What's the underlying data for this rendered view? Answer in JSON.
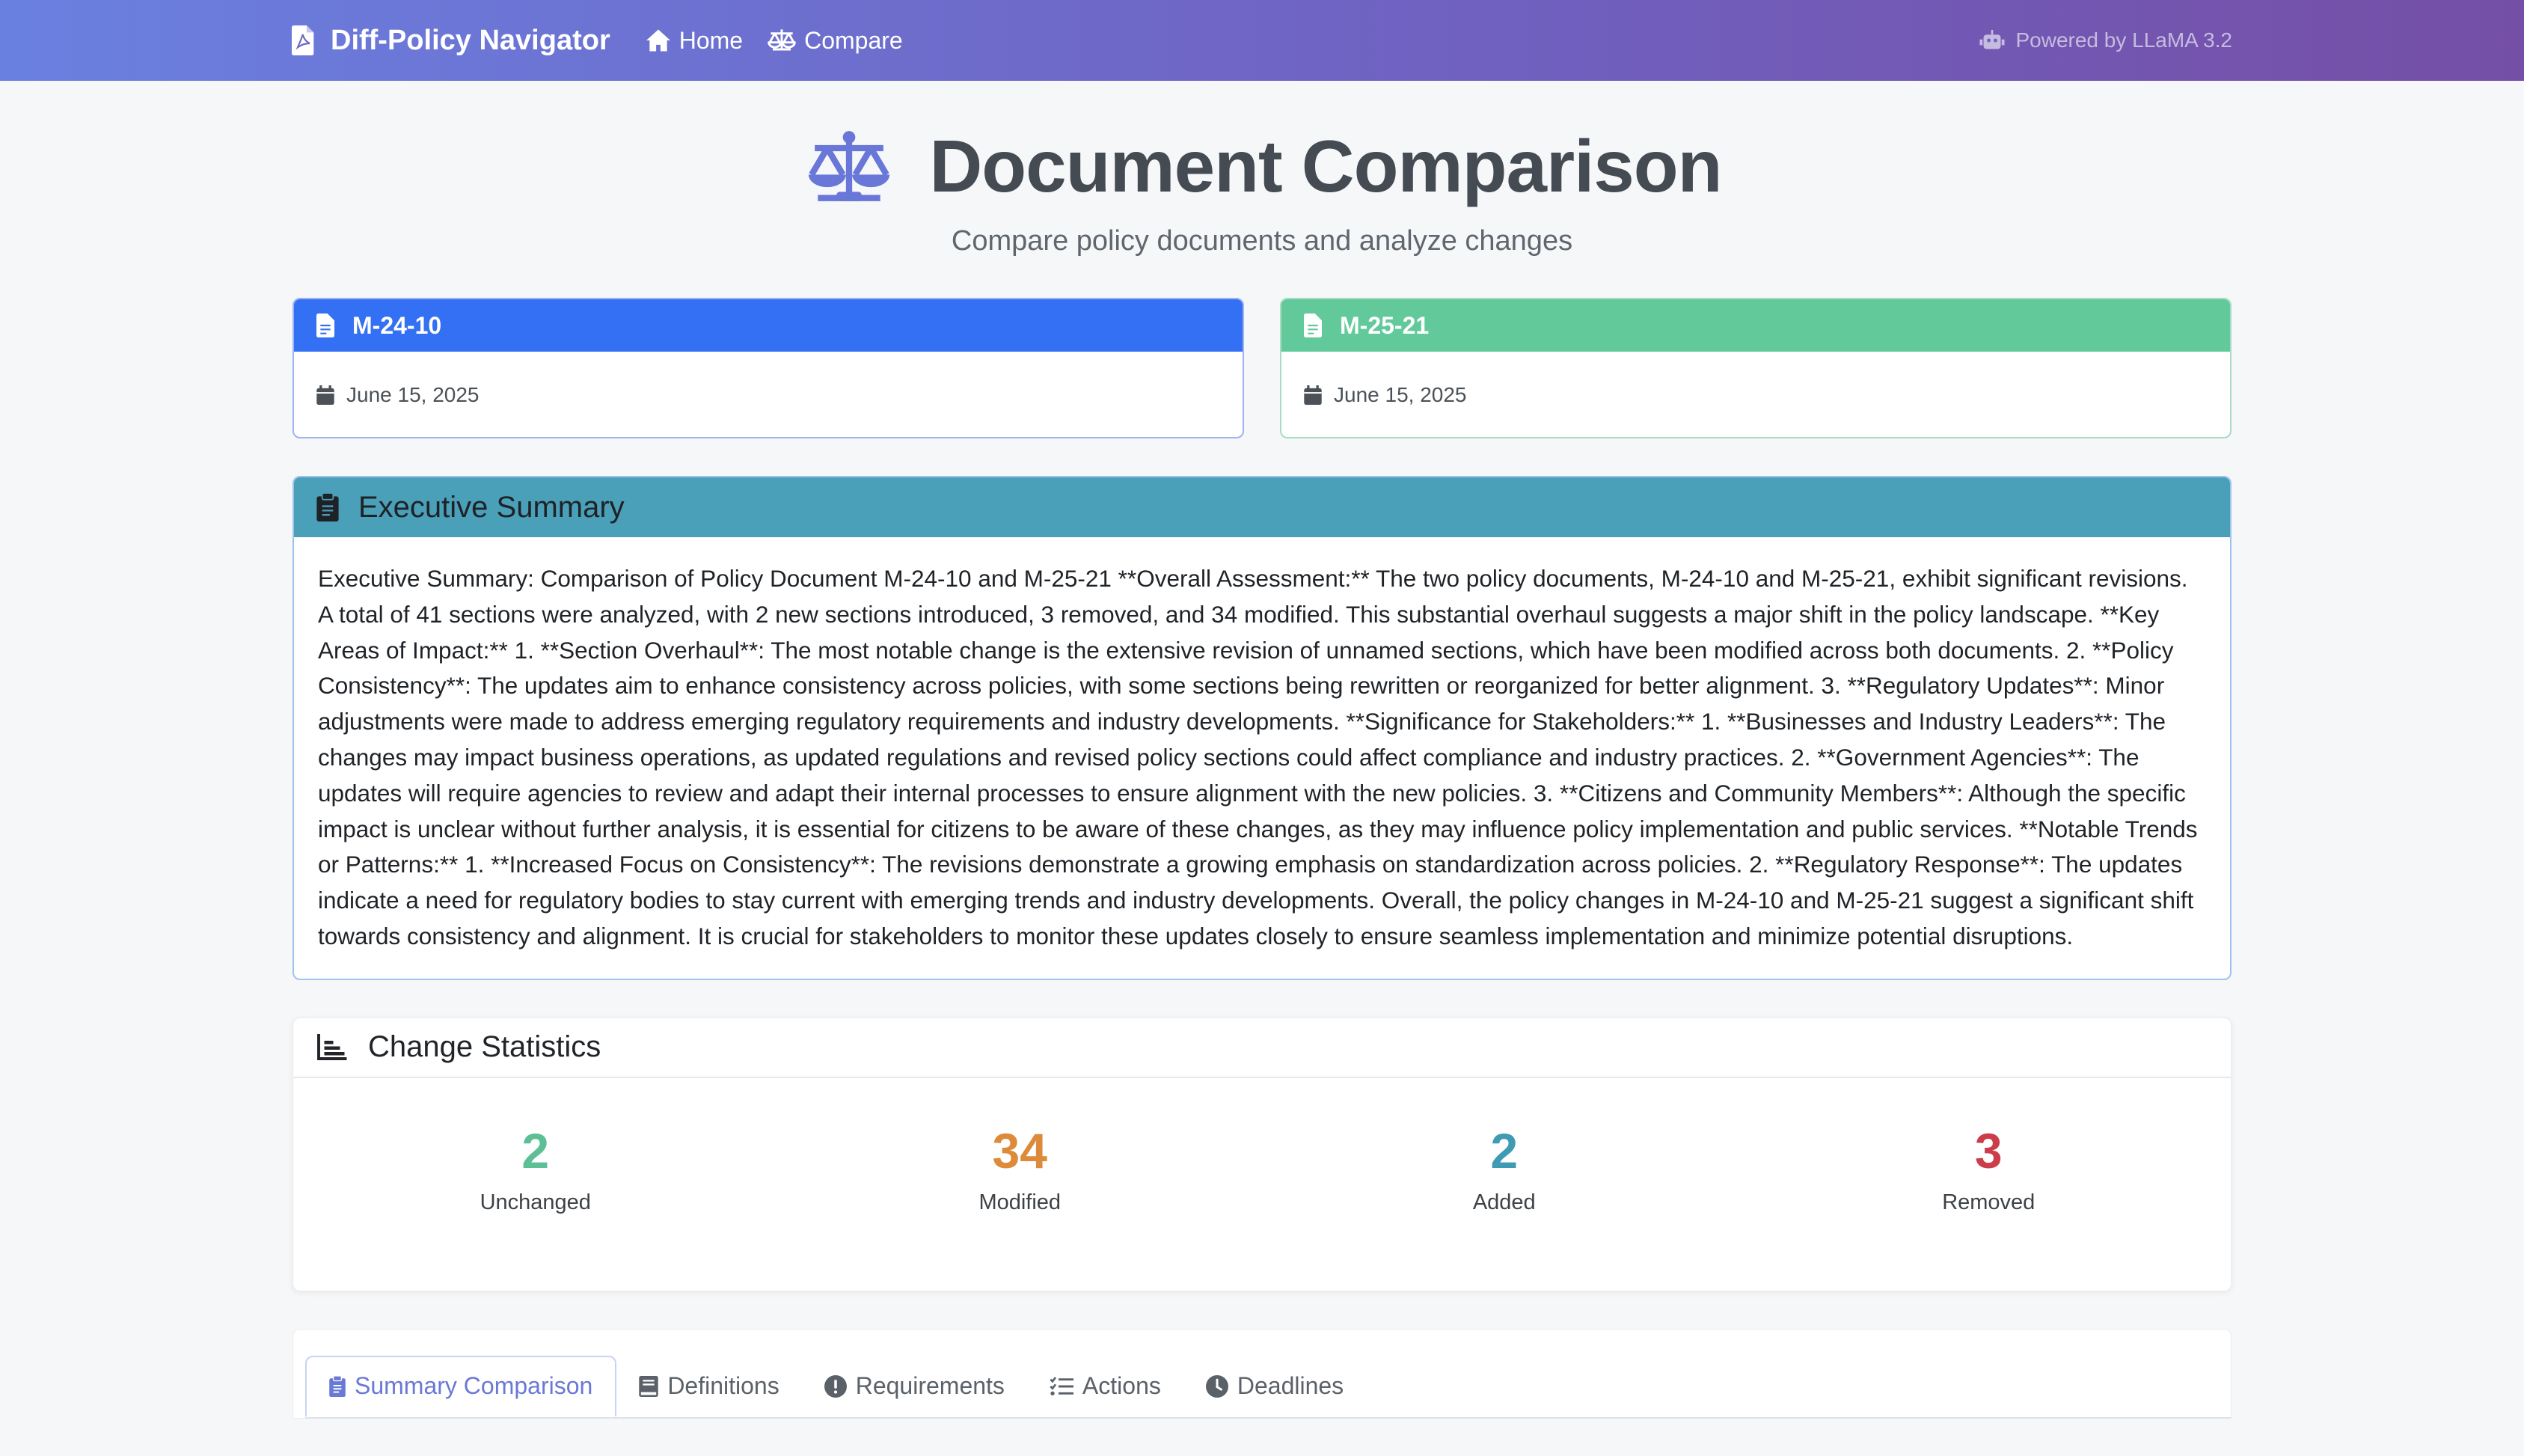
{
  "navbar": {
    "brand": "Diff-Policy Navigator",
    "links": [
      {
        "label": "Home",
        "icon": "home-icon"
      },
      {
        "label": "Compare",
        "icon": "scale-icon"
      }
    ],
    "powered_by": "Powered by LLaMA 3.2"
  },
  "hero": {
    "title": "Document Comparison",
    "subtitle": "Compare policy documents and analyze changes"
  },
  "documents": [
    {
      "name": "M-24-10",
      "date": "June 15, 2025",
      "color": "#3470f3"
    },
    {
      "name": "M-25-21",
      "date": "June 15, 2025",
      "color": "#62c99a"
    }
  ],
  "executive_summary": {
    "title": "Executive Summary",
    "text": "Executive Summary: Comparison of Policy Document M-24-10 and M-25-21 **Overall Assessment:** The two policy documents, M-24-10 and M-25-21, exhibit significant revisions. A total of 41 sections were analyzed, with 2 new sections introduced, 3 removed, and 34 modified. This substantial overhaul suggests a major shift in the policy landscape. **Key Areas of Impact:** 1. **Section Overhaul**: The most notable change is the extensive revision of unnamed sections, which have been modified across both documents. 2. **Policy Consistency**: The updates aim to enhance consistency across policies, with some sections being rewritten or reorganized for better alignment. 3. **Regulatory Updates**: Minor adjustments were made to address emerging regulatory requirements and industry developments. **Significance for Stakeholders:** 1. **Businesses and Industry Leaders**: The changes may impact business operations, as updated regulations and revised policy sections could affect compliance and industry practices. 2. **Government Agencies**: The updates will require agencies to review and adapt their internal processes to ensure alignment with the new policies. 3. **Citizens and Community Members**: Although the specific impact is unclear without further analysis, it is essential for citizens to be aware of these changes, as they may influence policy implementation and public services. **Notable Trends or Patterns:** 1. **Increased Focus on Consistency**: The revisions demonstrate a growing emphasis on standardization across policies. 2. **Regulatory Response**: The updates indicate a need for regulatory bodies to stay current with emerging trends and industry developments. Overall, the policy changes in M-24-10 and M-25-21 suggest a significant shift towards consistency and alignment. It is crucial for stakeholders to monitor these updates closely to ensure seamless implementation and minimize potential disruptions."
  },
  "change_statistics": {
    "title": "Change Statistics",
    "items": [
      {
        "value": "2",
        "label": "Unchanged",
        "color": "#5cbf95"
      },
      {
        "value": "34",
        "label": "Modified",
        "color": "#dd8a3b"
      },
      {
        "value": "2",
        "label": "Added",
        "color": "#3e9bb3"
      },
      {
        "value": "3",
        "label": "Removed",
        "color": "#cc3d4b"
      }
    ]
  },
  "tabs": [
    {
      "label": "Summary Comparison",
      "icon": "clipboard-icon",
      "active": true
    },
    {
      "label": "Definitions",
      "icon": "book-icon",
      "active": false
    },
    {
      "label": "Requirements",
      "icon": "exclamation-circle-icon",
      "active": false
    },
    {
      "label": "Actions",
      "icon": "list-check-icon",
      "active": false
    },
    {
      "label": "Deadlines",
      "icon": "clock-icon",
      "active": false
    }
  ]
}
